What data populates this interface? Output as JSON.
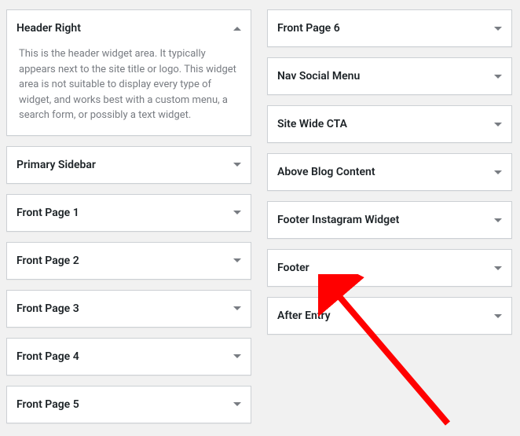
{
  "left_column": [
    {
      "id": "header-right",
      "title": "Header Right",
      "expanded": true,
      "description": "This is the header widget area. It typically appears next to the site title or logo. This widget area is not suitable to display every type of widget, and works best with a custom menu, a search form, or possibly a text widget."
    },
    {
      "id": "primary-sidebar",
      "title": "Primary Sidebar",
      "expanded": false
    },
    {
      "id": "front-page-1",
      "title": "Front Page 1",
      "expanded": false
    },
    {
      "id": "front-page-2",
      "title": "Front Page 2",
      "expanded": false
    },
    {
      "id": "front-page-3",
      "title": "Front Page 3",
      "expanded": false
    },
    {
      "id": "front-page-4",
      "title": "Front Page 4",
      "expanded": false
    },
    {
      "id": "front-page-5",
      "title": "Front Page 5",
      "expanded": false
    }
  ],
  "right_column": [
    {
      "id": "front-page-6",
      "title": "Front Page 6",
      "expanded": false
    },
    {
      "id": "nav-social-menu",
      "title": "Nav Social Menu",
      "expanded": false
    },
    {
      "id": "site-wide-cta",
      "title": "Site Wide CTA",
      "expanded": false
    },
    {
      "id": "above-blog-content",
      "title": "Above Blog Content",
      "expanded": false
    },
    {
      "id": "footer-instagram-widget",
      "title": "Footer Instagram Widget",
      "expanded": false
    },
    {
      "id": "footer",
      "title": "Footer",
      "expanded": false
    },
    {
      "id": "after-entry",
      "title": "After Entry",
      "expanded": false
    }
  ]
}
